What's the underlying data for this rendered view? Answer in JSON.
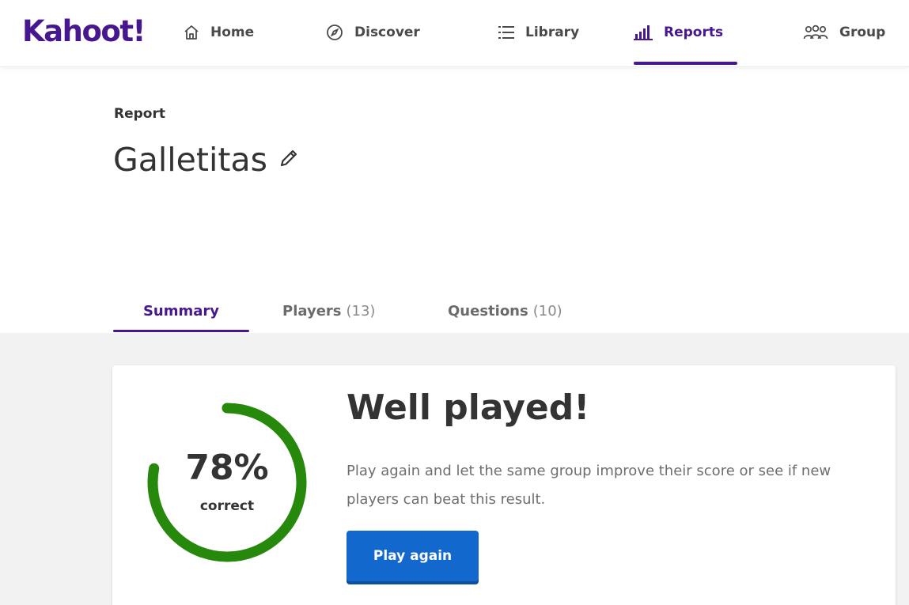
{
  "brand": {
    "logo_text": "Kahoot!",
    "color": "#46178f"
  },
  "nav": {
    "items": [
      {
        "label": "Home",
        "icon": "home-icon",
        "active": false
      },
      {
        "label": "Discover",
        "icon": "compass-icon",
        "active": false
      },
      {
        "label": "Library",
        "icon": "list-icon",
        "active": false
      },
      {
        "label": "Reports",
        "icon": "bar-chart-icon",
        "active": true
      },
      {
        "label": "Group",
        "icon": "groups-icon",
        "active": false
      }
    ]
  },
  "report": {
    "label": "Report",
    "title": "Galletitas",
    "edit_icon": "pencil-icon"
  },
  "tabs": [
    {
      "label": "Summary",
      "count": "",
      "active": true
    },
    {
      "label": "Players",
      "count": "(13)",
      "active": false
    },
    {
      "label": "Questions",
      "count": "(10)",
      "active": false
    }
  ],
  "summary": {
    "percent_correct": 78,
    "percent_text": "78%",
    "percent_label": "correct",
    "headline": "Well played!",
    "description": "Play again and let the same group improve their score or see if new players can beat this result.",
    "button_label": "Play again",
    "gauge_color": "#26890c",
    "button_color": "#1368ce"
  }
}
